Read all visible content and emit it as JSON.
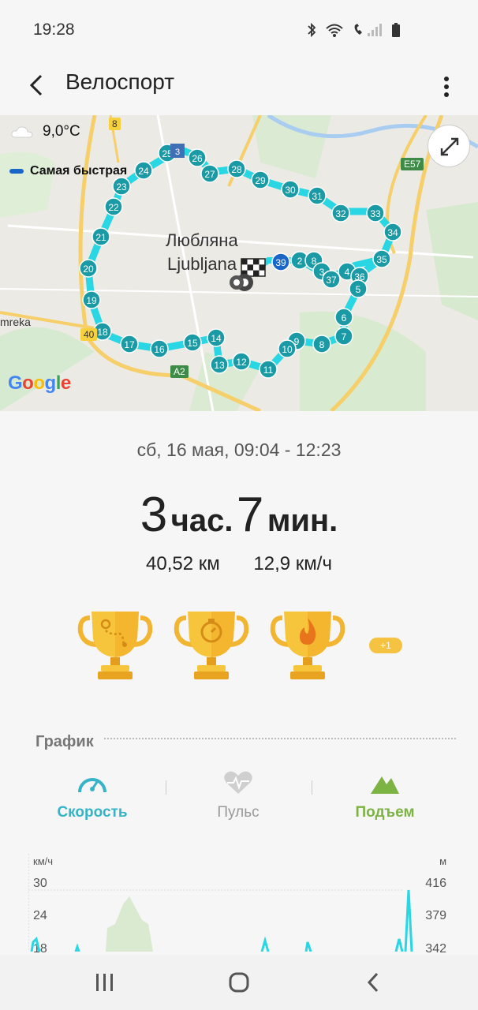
{
  "status_bar": {
    "time": "19:28"
  },
  "app_bar": {
    "title": "Велоспорт"
  },
  "map": {
    "temperature": "9,0°C",
    "legend_fastest": "Самая быстрая",
    "city_ru": "Любляна",
    "city_latin": "Ljubljana",
    "label_mreka": "mreka",
    "road_8": "8",
    "road_40": "40",
    "road_a2": "A2",
    "road_e57": "E57",
    "google": "Google",
    "waypoints": [
      "2",
      "3",
      "4",
      "5",
      "6",
      "7",
      "8",
      "9",
      "10",
      "11",
      "12",
      "13",
      "14",
      "15",
      "16",
      "17",
      "18",
      "19",
      "20",
      "21",
      "22",
      "23",
      "24",
      "25",
      "26",
      "27",
      "28",
      "29",
      "30",
      "31",
      "32",
      "33",
      "34",
      "35",
      "36",
      "37",
      "39"
    ],
    "route_color": "#29d6e3",
    "marker_color": "#1a9aa5"
  },
  "workout": {
    "date_range": "сб, 16 мая, 09:04 - 12:23",
    "hours_value": "3",
    "hours_unit": "час.",
    "minutes_value": "7",
    "minutes_unit": "мин.",
    "distance": "40,52 км",
    "avg_speed": "12,9 км/ч",
    "extra_badge": "+1"
  },
  "trophies": [
    "route-trophy-icon",
    "stopwatch-trophy-icon",
    "flame-trophy-icon"
  ],
  "graph": {
    "section_title": "График",
    "tabs": [
      {
        "label": "Скорость",
        "color": "#35b4c8"
      },
      {
        "label": "Пульс",
        "color": "#999999"
      },
      {
        "label": "Подъем",
        "color": "#7cb342"
      }
    ],
    "left_unit": "км/ч",
    "right_unit": "м",
    "left_ticks": [
      "30",
      "24",
      "18"
    ],
    "right_ticks": [
      "416",
      "379",
      "342"
    ]
  }
}
